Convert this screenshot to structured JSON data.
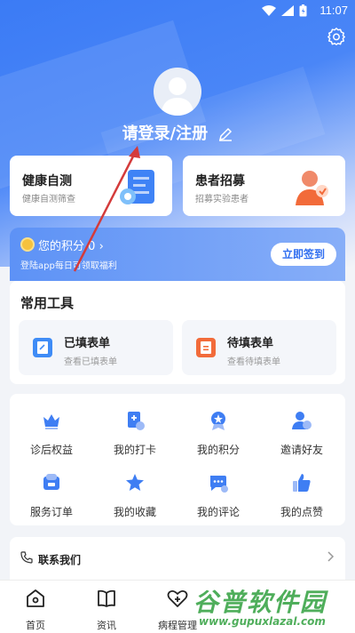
{
  "status": {
    "time": "11:07"
  },
  "profile": {
    "login_text": "请登录/注册"
  },
  "cards": [
    {
      "title": "健康自测",
      "subtitle": "健康自测筛查"
    },
    {
      "title": "患者招募",
      "subtitle": "招募实验患者"
    }
  ],
  "points": {
    "label": "您的积分",
    "value": "0",
    "subtitle": "登陆app每日可领取福利",
    "checkin_label": "立即签到"
  },
  "tools": {
    "title": "常用工具",
    "items": [
      {
        "title": "已填表单",
        "subtitle": "查看已填表单"
      },
      {
        "title": "待填表单",
        "subtitle": "查看待填表单"
      }
    ]
  },
  "grid": {
    "items": [
      {
        "label": "诊后权益",
        "icon": "crown-icon"
      },
      {
        "label": "我的打卡",
        "icon": "checkin-icon"
      },
      {
        "label": "我的积分",
        "icon": "medal-icon"
      },
      {
        "label": "邀请好友",
        "icon": "invite-user-icon"
      },
      {
        "label": "服务订单",
        "icon": "order-icon"
      },
      {
        "label": "我的收藏",
        "icon": "star-icon"
      },
      {
        "label": "我的评论",
        "icon": "comment-icon"
      },
      {
        "label": "我的点赞",
        "icon": "thumbs-up-icon"
      }
    ]
  },
  "contact": {
    "label": "联系我们"
  },
  "tabbar": {
    "items": [
      {
        "label": "首页"
      },
      {
        "label": "资讯"
      },
      {
        "label": "病程管理"
      }
    ]
  },
  "watermark": {
    "main": "谷普软件园",
    "url": "www.gupuxlazal.com"
  },
  "colors": {
    "primary": "#3b7bf5",
    "accent": "#4a86f7",
    "orange": "#f26b3a",
    "watermark_green": "#4fae5b"
  }
}
